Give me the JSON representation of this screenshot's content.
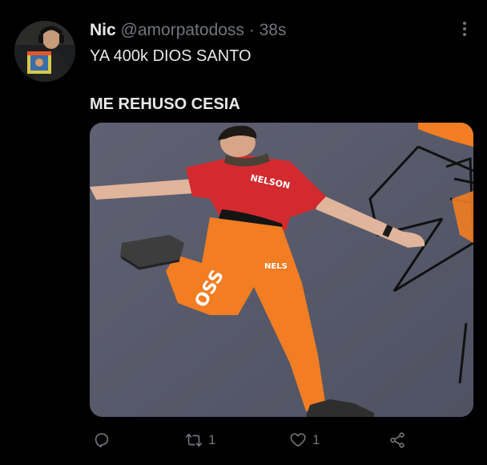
{
  "tweet": {
    "author": {
      "display_name": "Nic",
      "handle": "@amorpatodoss",
      "separator": "·",
      "time": "38s"
    },
    "lines": [
      "YA 400k DIOS SANTO",
      "ME REHUSO CESIA"
    ],
    "media": {
      "shirt_text": "NELSON",
      "pants_text": "NELS",
      "leg_text": "OSS"
    },
    "actions": {
      "reply_icon": "reply-icon",
      "retweet_icon": "retweet-icon",
      "retweet_count": "1",
      "like_icon": "heart-icon",
      "like_count": "1",
      "share_icon": "share-icon"
    }
  },
  "colors": {
    "background": "#000000",
    "text_primary": "#e7e9ea",
    "text_secondary": "#71767b",
    "orange": "#f27d22",
    "shirt_red": "#d32a2f"
  }
}
